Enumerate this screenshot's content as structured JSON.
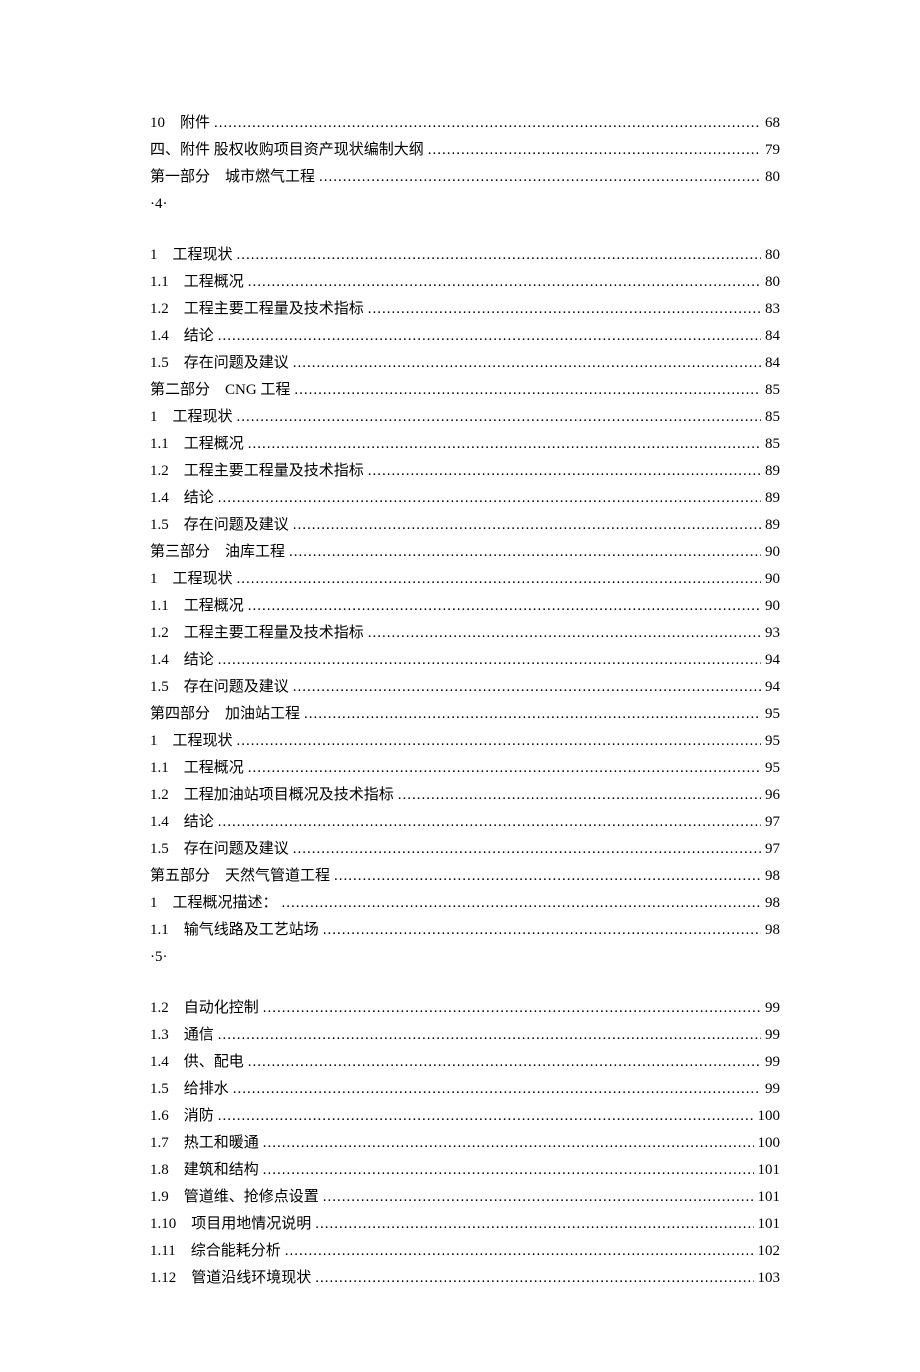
{
  "entries": [
    {
      "label": "10　附件",
      "page": "68"
    },
    {
      "label": "四、附件 股权收购项目资产现状编制大纲",
      "page": "79"
    },
    {
      "label": "第一部分　城市燃气工程",
      "page": "80"
    },
    {
      "marker": "·4·"
    },
    {
      "spacer": true
    },
    {
      "label": "1　工程现状",
      "page": "80"
    },
    {
      "label": "1.1　工程概况",
      "page": "80"
    },
    {
      "label": "1.2　工程主要工程量及技术指标",
      "page": "83"
    },
    {
      "label": "1.4　结论",
      "page": "84"
    },
    {
      "label": "1.5　存在问题及建议",
      "page": "84"
    },
    {
      "label": "第二部分　CNG 工程",
      "page": "85"
    },
    {
      "label": "1　工程现状",
      "page": "85"
    },
    {
      "label": "1.1　工程概况",
      "page": "85"
    },
    {
      "label": "1.2　工程主要工程量及技术指标",
      "page": "89"
    },
    {
      "label": "1.4　结论",
      "page": "89"
    },
    {
      "label": "1.5　存在问题及建议",
      "page": "89"
    },
    {
      "label": "第三部分　油库工程",
      "page": "90"
    },
    {
      "label": "1　工程现状",
      "page": "90"
    },
    {
      "label": "1.1　工程概况",
      "page": "90"
    },
    {
      "label": "1.2　工程主要工程量及技术指标",
      "page": "93"
    },
    {
      "label": "1.4　结论",
      "page": "94"
    },
    {
      "label": "1.5　存在问题及建议",
      "page": "94"
    },
    {
      "label": "第四部分　加油站工程",
      "page": "95"
    },
    {
      "label": "1　工程现状",
      "page": "95"
    },
    {
      "label": "1.1　工程概况",
      "page": "95"
    },
    {
      "label": "1.2　工程加油站项目概况及技术指标",
      "page": "96"
    },
    {
      "label": "1.4　结论",
      "page": "97"
    },
    {
      "label": "1.5　存在问题及建议",
      "page": "97"
    },
    {
      "label": "第五部分　天然气管道工程",
      "page": "98"
    },
    {
      "label": "1　工程概况描述：",
      "page": "98"
    },
    {
      "label": "1.1　输气线路及工艺站场",
      "page": "98"
    },
    {
      "marker": "·5·"
    },
    {
      "spacer": true
    },
    {
      "label": "1.2　自动化控制",
      "page": "99"
    },
    {
      "label": "1.3　通信",
      "page": "99"
    },
    {
      "label": "1.4　供、配电",
      "page": "99"
    },
    {
      "label": "1.5　给排水",
      "page": "99"
    },
    {
      "label": "1.6　消防",
      "page": "100"
    },
    {
      "label": "1.7　热工和暖通",
      "page": "100"
    },
    {
      "label": "1.8　建筑和结构",
      "page": "101"
    },
    {
      "label": "1.9　管道维、抢修点设置",
      "page": "101"
    },
    {
      "label": "1.10　项目用地情况说明",
      "page": "101"
    },
    {
      "label": "1.11　综合能耗分析",
      "page": "102"
    },
    {
      "label": "1.12　管道沿线环境现状",
      "page": "103"
    }
  ]
}
